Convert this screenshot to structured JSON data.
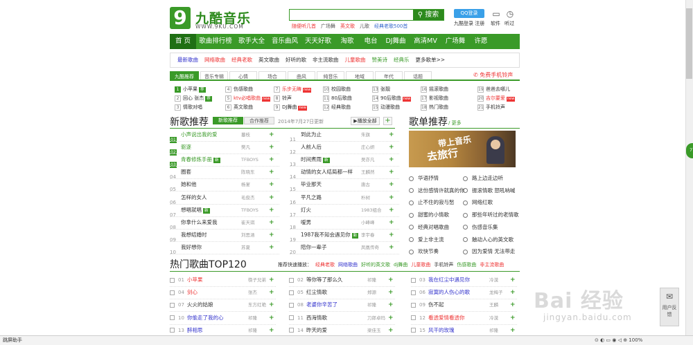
{
  "header": {
    "logo_mark": "9",
    "logo_text": "九酷音乐",
    "logo_url": "WWW.9KU.COM",
    "search_value": "",
    "search_button": "搜索",
    "hot_words": [
      {
        "text": "随便听几首",
        "color": "red"
      },
      {
        "text": "广场舞",
        "color": "normal"
      },
      {
        "text": "英文歌",
        "color": "red"
      },
      {
        "text": "儿歌",
        "color": "normal"
      },
      {
        "text": "经典老歌500首",
        "color": "blue"
      }
    ],
    "qq_login": "QQ登录",
    "login_links": "九酷登录  注册",
    "icons": [
      {
        "label": "软件",
        "glyph": "▭"
      },
      {
        "label": "听过",
        "glyph": "◷"
      }
    ]
  },
  "nav": [
    "首 页",
    "歌曲排行榜",
    "歌手大全",
    "音乐曲风",
    "天天好歌",
    "淘歌",
    "电台",
    "DJ舞曲",
    "高清MV",
    "广场舞",
    "许愿"
  ],
  "categories": [
    {
      "text": "最新歌曲",
      "color": "#33c"
    },
    {
      "text": "网络歌曲",
      "color": "#e33"
    },
    {
      "text": "经典老歌",
      "color": "#e33"
    },
    {
      "text": "英文歌曲",
      "color": "#333"
    },
    {
      "text": "好听的歌",
      "color": "#333"
    },
    {
      "text": "非主流歌曲",
      "color": "#333"
    },
    {
      "text": "儿童歌曲",
      "color": "#e33"
    },
    {
      "text": "赞美诗",
      "color": "#3a9a28"
    },
    {
      "text": "经典乐",
      "color": "#3a9a28"
    },
    {
      "text": "更多歌单>>",
      "color": "#333"
    }
  ],
  "tabs": [
    "九酷推荐",
    "音乐专辑",
    "心情",
    "场合",
    "曲风",
    "纯音乐",
    "地域",
    "年代",
    "话题"
  ],
  "free_ring": "免费手机铃声",
  "quick_grid": [
    {
      "n": "1",
      "t": "小苹果",
      "tag": "g",
      "red": false
    },
    {
      "n": "4",
      "t": "伤感歌曲",
      "tag": "",
      "red": false
    },
    {
      "n": "7",
      "t": "乐步无畴",
      "tag": "r",
      "red": true
    },
    {
      "n": "10",
      "t": "校园歌曲",
      "tag": "",
      "red": false
    },
    {
      "n": "13",
      "t": "张靓",
      "tag": "",
      "red": false
    },
    {
      "n": "16",
      "t": "摇滚歌曲",
      "tag": "",
      "red": false
    },
    {
      "n": "19",
      "t": "爸爸去哪儿",
      "tag": "",
      "red": false
    },
    {
      "n": "2",
      "t": "回心 张杰",
      "tag": "g",
      "red": false
    },
    {
      "n": "5",
      "t": "ktv必唱歌曲",
      "tag": "r",
      "red": true
    },
    {
      "n": "8",
      "t": "铃声",
      "tag": "",
      "red": false
    },
    {
      "n": "11",
      "t": "80后歌曲",
      "tag": "",
      "red": false
    },
    {
      "n": "14",
      "t": "90后歌曲",
      "tag": "r",
      "red": false
    },
    {
      "n": "17",
      "t": "影视歌曲",
      "tag": "",
      "red": false
    },
    {
      "n": "20",
      "t": "吉尔要爱",
      "tag": "r",
      "red": true
    },
    {
      "n": "3",
      "t": "情歌对唱",
      "tag": "",
      "red": false
    },
    {
      "n": "6",
      "t": "英文歌曲",
      "tag": "",
      "red": false
    },
    {
      "n": "9",
      "t": "DJ舞曲",
      "tag": "r",
      "red": false
    },
    {
      "n": "12",
      "t": "经典歌曲",
      "tag": "",
      "red": false
    },
    {
      "n": "15",
      "t": "动漫歌曲",
      "tag": "",
      "red": false
    },
    {
      "n": "18",
      "t": "热门歌曲",
      "tag": "",
      "red": false
    },
    {
      "n": "21",
      "t": "手机铃声",
      "tag": "",
      "red": false
    }
  ],
  "new_songs": {
    "title": "新歌推荐",
    "tab1": "新歌推荐",
    "tab2": "合作推荐",
    "date": "2014年7月27日更新",
    "play_all": "▶播放全部",
    "add_all": "+",
    "left": [
      {
        "n": "01",
        "t": "小声说出我的爱",
        "a": "蔓枝",
        "g": true
      },
      {
        "n": "02",
        "t": "驱逐",
        "a": "樊凡",
        "g": true
      },
      {
        "n": "03",
        "t": "青春修炼手册",
        "a": "TFBOYS",
        "g": true,
        "tag": true
      },
      {
        "n": "04",
        "t": "圈套",
        "a": "陈晓东",
        "g": false
      },
      {
        "n": "05",
        "t": "她和他",
        "a": "杨宴",
        "g": false
      },
      {
        "n": "06",
        "t": "怎样的女人",
        "a": "毛俊杰",
        "g": false
      },
      {
        "n": "07",
        "t": "想唱就唱",
        "a": "TFBOYS",
        "g": false,
        "tag": true
      },
      {
        "n": "08",
        "t": "你拿什么来爱我",
        "a": "崔天琪",
        "g": false
      },
      {
        "n": "09",
        "t": "我想结婚时",
        "a": "刘思涵",
        "g": false
      },
      {
        "n": "10",
        "t": "我好想你",
        "a": "苏夏",
        "g": false
      }
    ],
    "right": [
      {
        "n": "11",
        "t": "到此为止",
        "a": "朱旗"
      },
      {
        "n": "12",
        "t": "人前人后",
        "a": "庄心妍"
      },
      {
        "n": "13",
        "t": "时间煮雨",
        "a": "吴亦凡",
        "tag": true
      },
      {
        "n": "14",
        "t": "动情的女人结局都一样",
        "a": "王麟然"
      },
      {
        "n": "15",
        "t": "毕业那天",
        "a": "唐古"
      },
      {
        "n": "16",
        "t": "平凡之路",
        "a": "朴树"
      },
      {
        "n": "17",
        "t": "灯火",
        "a": "1983组合"
      },
      {
        "n": "18",
        "t": "嗳男",
        "a": "小峰峰"
      },
      {
        "n": "19",
        "t": "1987我不知会遇见你",
        "a": "李宇春",
        "tag": true
      },
      {
        "n": "20",
        "t": "陪你一辈子",
        "a": "凤凰传奇"
      }
    ]
  },
  "playlist": {
    "title": "歌单推荐",
    "more": "/ 更多",
    "banner_line1": "带上音乐",
    "banner_line2": "去旅行",
    "left": [
      "华语抒情",
      "这份感情许就真的你",
      "止不住的寂与愁",
      "甜蜜的小情歌",
      "经典对唱歌曲",
      "爱上非主流",
      "欢快节奏"
    ],
    "right": [
      "路上边走边听",
      "振滚情歌 怒吼呐喊",
      "网络红歌",
      "那些年听过的老情歌",
      "伤感音乐集",
      "触动人心的英文歌",
      "因为爱情 无法带走"
    ]
  },
  "top120": {
    "title": "热门歌曲TOP120",
    "quick_label": "推荐快速播放：",
    "quick": [
      {
        "t": "经典老歌",
        "c": "c-red"
      },
      {
        "t": "网络歌曲",
        "c": "c-blue"
      },
      {
        "t": "好听的英文歌",
        "c": "c-green"
      },
      {
        "t": "dj舞曲",
        "c": "c-green"
      },
      {
        "t": "儿童歌曲",
        "c": "c-red"
      },
      {
        "t": "手机铃声",
        "c": ""
      },
      {
        "t": "伤感歌曲",
        "c": "c-green"
      },
      {
        "t": "非主流歌曲",
        "c": "c-red"
      }
    ],
    "col1": [
      {
        "n": "01",
        "t": "小苹果",
        "a": "筷子兄弟",
        "c": "c-red"
      },
      {
        "n": "04",
        "t": "剑心",
        "a": "张杰",
        "c": "c-red"
      },
      {
        "n": "07",
        "t": "火火的姑娘",
        "a": "东方红艳",
        "c": ""
      },
      {
        "n": "10",
        "t": "你偷走了我的心",
        "a": "祁隆",
        "c": "c-blue"
      },
      {
        "n": "13",
        "t": "醉相思",
        "a": "祁隆",
        "c": "c-blue"
      }
    ],
    "col2": [
      {
        "n": "02",
        "t": "等你等了那么久",
        "a": "祁隆",
        "c": ""
      },
      {
        "n": "05",
        "t": "红尘情歌",
        "a": "郑源",
        "c": ""
      },
      {
        "n": "08",
        "t": "老婆你辛苦了",
        "a": "祁隆",
        "c": "c-blue"
      },
      {
        "n": "11",
        "t": "西海情歌",
        "a": "刀郎卓玛",
        "c": ""
      },
      {
        "n": "14",
        "t": "昨天的爱",
        "a": "梁佳玉",
        "c": ""
      }
    ],
    "col3": [
      {
        "n": "03",
        "t": "我在红尘中遇见你",
        "a": "冷漠",
        "c": "c-blue"
      },
      {
        "n": "06",
        "t": "寂寞的人伤心的歌",
        "a": "龙梅子",
        "c": "c-blue"
      },
      {
        "n": "09",
        "t": "伤不起",
        "a": "王麟",
        "c": ""
      },
      {
        "n": "12",
        "t": "看透爱情看透你",
        "a": "冷漠",
        "c": "c-red"
      },
      {
        "n": "15",
        "t": "风干的玫瑰",
        "a": "祁隆",
        "c": "c-blue"
      }
    ]
  },
  "side_badge": "77",
  "status": {
    "left": "跳屏助手",
    "right": "⊙ ◐ ▭ ◉ ◁ ⊕ 100%"
  },
  "watermark": {
    "brand": "Bai 经验",
    "url": "jingyan.baidu.com"
  },
  "feedback": "用户反馈"
}
